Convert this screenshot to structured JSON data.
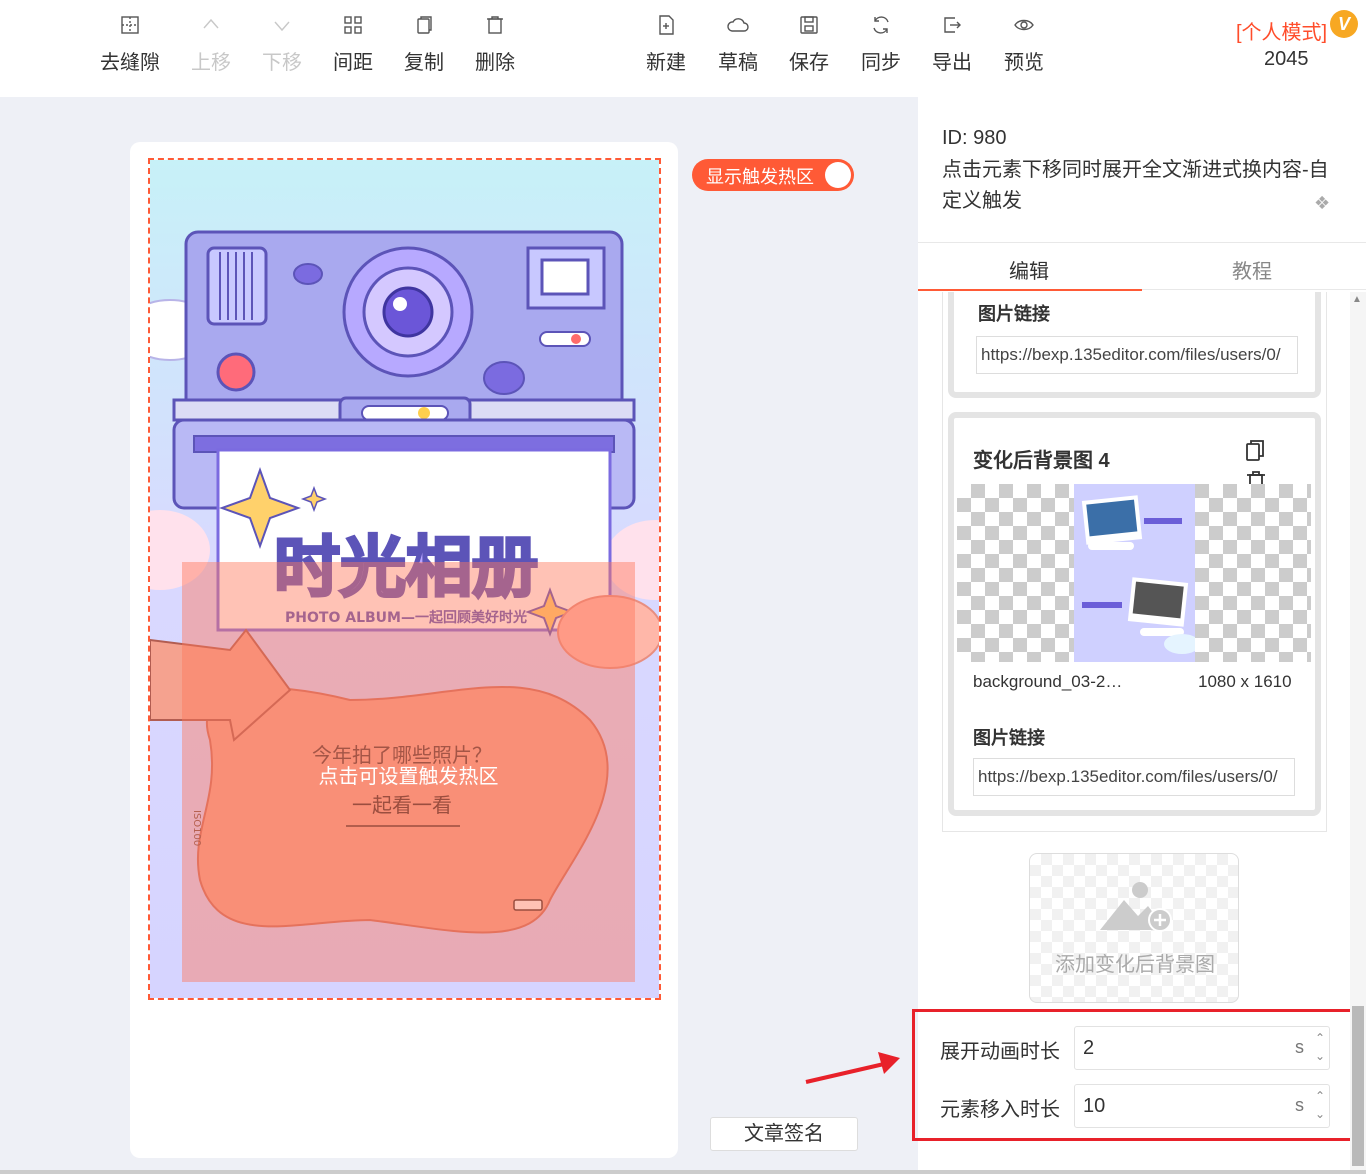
{
  "toolbar": {
    "left_tools": [
      {
        "icon": "seam-icon",
        "label": "去缝隙",
        "disabled": false
      },
      {
        "icon": "up-icon",
        "label": "上移",
        "disabled": true
      },
      {
        "icon": "down-icon",
        "label": "下移",
        "disabled": true
      },
      {
        "icon": "spacing-icon",
        "label": "间距",
        "disabled": false
      },
      {
        "icon": "copy-icon",
        "label": "复制",
        "disabled": false
      },
      {
        "icon": "trash-icon",
        "label": "删除",
        "disabled": false
      }
    ],
    "right_tools": [
      {
        "icon": "new-file-icon",
        "label": "新建"
      },
      {
        "icon": "cloud-icon",
        "label": "草稿"
      },
      {
        "icon": "save-icon",
        "label": "保存"
      },
      {
        "icon": "sync-icon",
        "label": "同步"
      },
      {
        "icon": "export-icon",
        "label": "导出"
      },
      {
        "icon": "eye-icon",
        "label": "预览"
      }
    ],
    "mode_label": "[个人模式]",
    "vip_badge": "V",
    "count": "2045"
  },
  "canvas": {
    "hotzone_toggle_label": "显示触发热区",
    "hotzone_hint": "点击可设置触发热区",
    "poster_title": "时光相册",
    "poster_subtitle": "PHOTO ALBUM—一起回顾美好时光",
    "poster_question": "今年拍了哪些照片？",
    "poster_cta": "一起看一看",
    "poster_side_text": "ISO100",
    "sign_button": "文章签名"
  },
  "panel": {
    "id_label": "ID: 980",
    "title": "点击元素下移同时展开全文渐进式换内容-自定义触发",
    "tabs": [
      "编辑",
      "教程"
    ],
    "card_a": {
      "link_label": "图片链接",
      "link_value": "https://bexp.135editor.com/files/users/0/"
    },
    "card_b": {
      "title": "变化后背景图 4",
      "filename": "background_03-2…",
      "dimensions": "1080 x 1610",
      "link_label": "图片链接",
      "link_value": "https://bexp.135editor.com/files/users/0/"
    },
    "add_background_label": "添加变化后背景图",
    "settings": [
      {
        "label": "展开动画时长",
        "value": "2",
        "unit": "s"
      },
      {
        "label": "元素移入时长",
        "value": "10",
        "unit": "s"
      }
    ]
  },
  "colors": {
    "accent": "#ff5a36",
    "highlight_box": "#e8212a"
  }
}
